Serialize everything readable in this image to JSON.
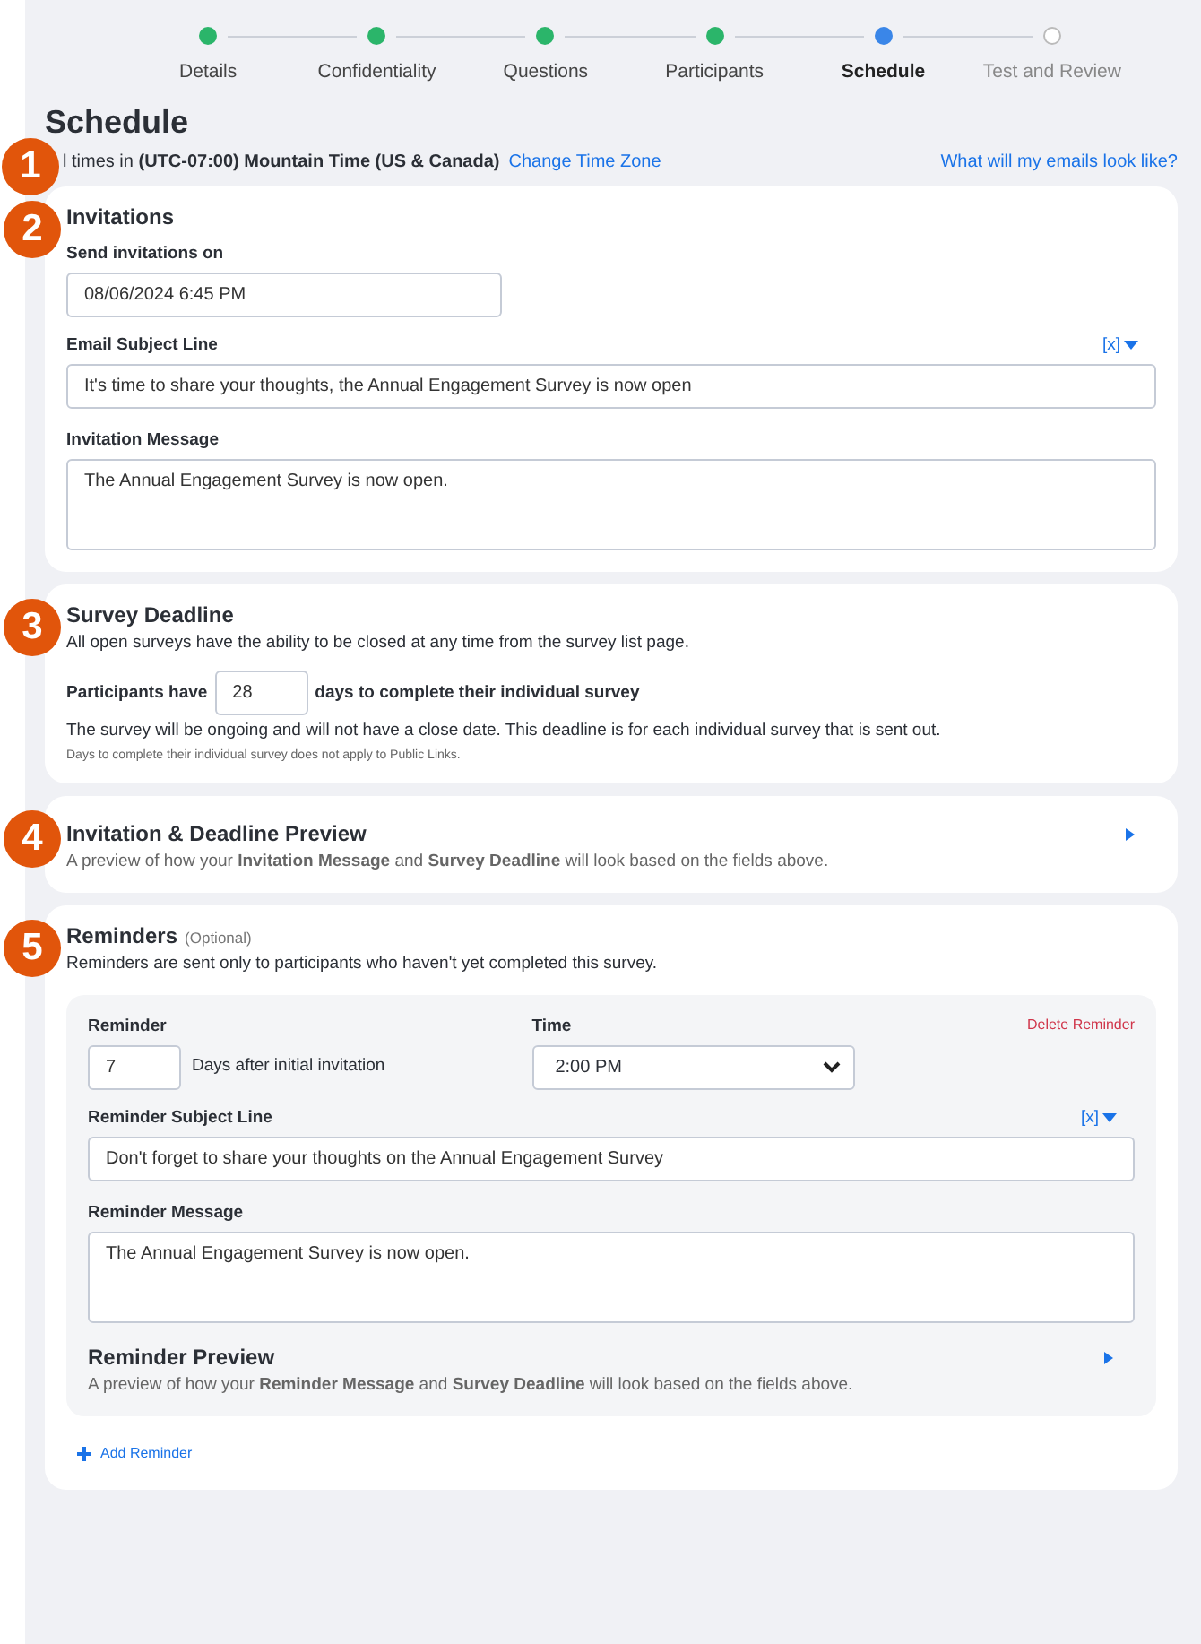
{
  "steps": [
    {
      "label": "Details",
      "completed": true,
      "selected": false
    },
    {
      "label": "Confidentiality",
      "completed": true,
      "selected": false
    },
    {
      "label": "Questions",
      "completed": true,
      "selected": false
    },
    {
      "label": "Participants",
      "completed": true,
      "selected": false
    },
    {
      "label": "Schedule",
      "completed": false,
      "selected": true
    },
    {
      "label": "Test and Review",
      "completed": false,
      "selected": false
    }
  ],
  "page_title": "Schedule",
  "timezone": {
    "text": "l times in **(UTC-07:00) Mountain Time (US & Canada)**",
    "link": "Change Time Zone",
    "emails_link": "What will my emails look like?"
  },
  "badges": [
    "1",
    "2",
    "3",
    "4",
    "5"
  ],
  "invitations": {
    "title": "Invitations",
    "send_label": "Send invitations on",
    "send_value": "08/06/2024 6:45 PM",
    "subject_label": "Email Subject Line",
    "token_button": "[x]",
    "subject_value": "It's time to share your thoughts, the Annual Engagement Survey is now open",
    "message_label": "Invitation Message",
    "message_value": "The Annual Engagement Survey is now open."
  },
  "deadline": {
    "title": "Survey Deadline",
    "description": "All open surveys have the ability to be closed at any time from the survey list page.",
    "before": "Participants have",
    "days": "28",
    "after": "days to complete their individual survey",
    "note": "The survey will be ongoing and will not have a close date. This deadline is for each individual survey that is sent out.",
    "small_note": "Days to complete their individual survey does not apply to Public Links."
  },
  "preview": {
    "title": "Invitation & Deadline Preview",
    "description": "A preview of how your **Invitation Message** and **Survey Deadline** will look based on the fields above.",
    "expanded": false
  },
  "reminders": {
    "title": "Reminders",
    "optional": "(Optional)",
    "description": "Reminders are sent only to participants who haven't yet completed this survey.",
    "items": [
      {
        "reminder_label": "Reminder",
        "days": "7",
        "days_suffix": "Days after initial invitation",
        "time_label": "Time",
        "time": "2:00 PM",
        "delete": "Delete Reminder",
        "subject_label": "Reminder Subject Line",
        "token_button": "[x]",
        "subject_value": "Don't forget to share your thoughts on the Annual Engagement Survey",
        "message_label": "Reminder Message",
        "message_value": "The Annual Engagement Survey is now open.",
        "preview_title": "Reminder Preview",
        "preview_description": "A preview of how your **Reminder Message** and **Survey Deadline** will look based on the fields above.",
        "preview_expanded": false
      }
    ],
    "add": "Add Reminder"
  }
}
